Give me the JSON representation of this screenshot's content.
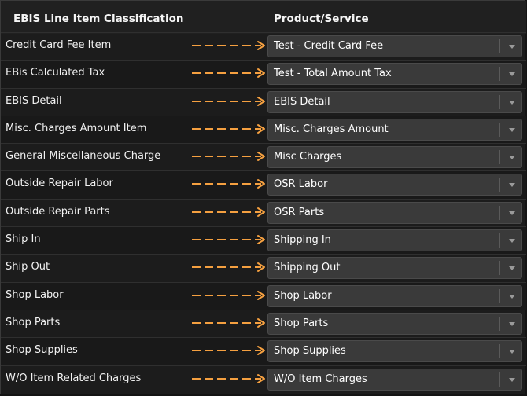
{
  "header": {
    "left_label": "EBIS Line Item Classification",
    "right_label": "Product/Service"
  },
  "colors": {
    "arrow": "#f5a040",
    "select_bg": "#3a3a3a"
  },
  "mappings": [
    {
      "label": "Credit Card Fee Item",
      "value": "Test - Credit Card Fee"
    },
    {
      "label": "EBis Calculated Tax",
      "value": "Test - Total Amount Tax"
    },
    {
      "label": "EBIS Detail",
      "value": "EBIS Detail"
    },
    {
      "label": "Misc. Charges Amount Item",
      "value": "Misc. Charges Amount"
    },
    {
      "label": "General Miscellaneous Charge",
      "value": "Misc Charges"
    },
    {
      "label": "Outside Repair Labor",
      "value": "OSR Labor"
    },
    {
      "label": "Outside Repair Parts",
      "value": "OSR Parts"
    },
    {
      "label": "Ship In",
      "value": "Shipping In"
    },
    {
      "label": "Ship Out",
      "value": "Shipping Out"
    },
    {
      "label": "Shop Labor",
      "value": "Shop Labor"
    },
    {
      "label": "Shop Parts",
      "value": "Shop Parts"
    },
    {
      "label": "Shop Supplies",
      "value": "Shop Supplies"
    },
    {
      "label": "W/O Item Related Charges",
      "value": "W/O Item Charges"
    }
  ]
}
